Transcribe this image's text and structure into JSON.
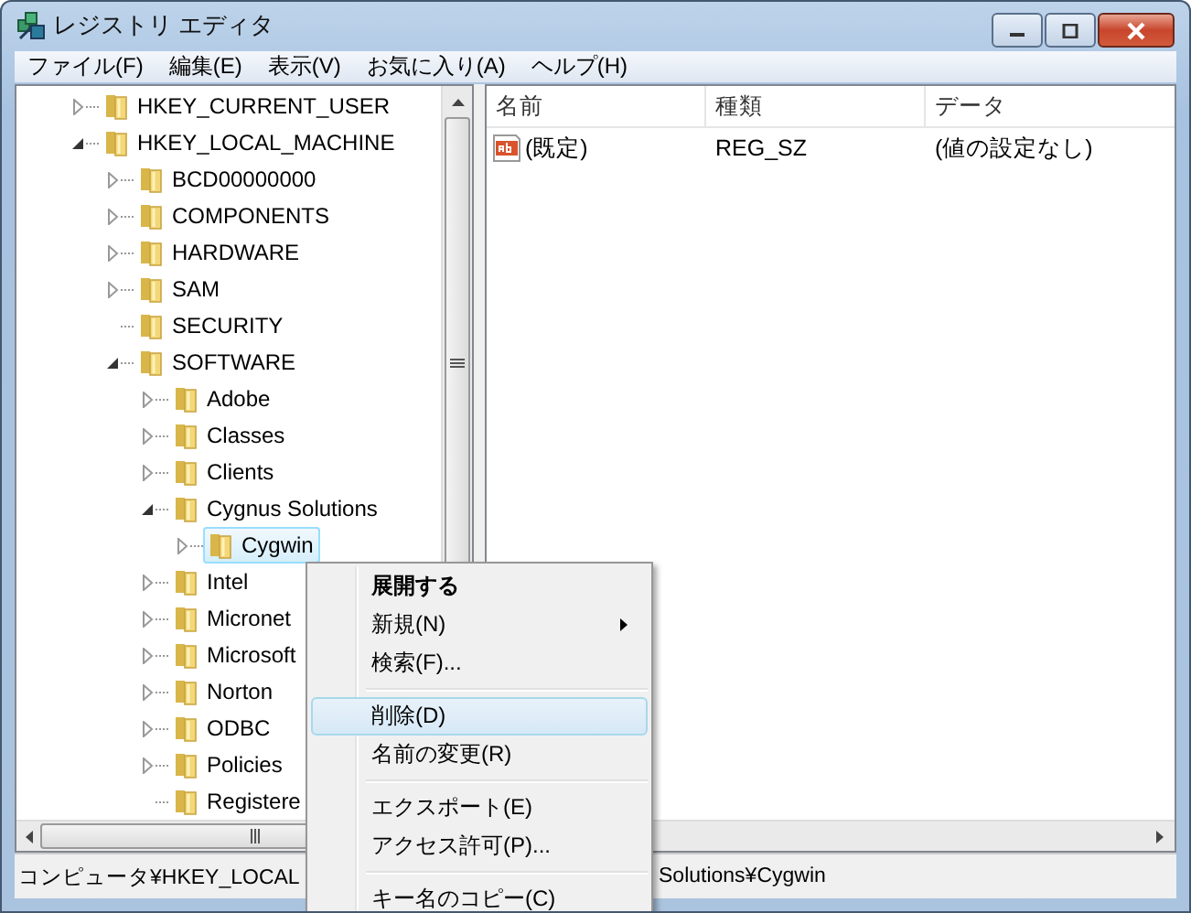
{
  "window": {
    "title": "レジストリ エディタ"
  },
  "menu_bar": [
    "ファイル(F)",
    "編集(E)",
    "表示(V)",
    "お気に入り(A)",
    "ヘルプ(H)"
  ],
  "tree": [
    {
      "label": "HKEY_CURRENT_USER",
      "expandable": true,
      "expanded": false,
      "selected": false
    },
    {
      "label": "HKEY_LOCAL_MACHINE",
      "expandable": true,
      "expanded": true,
      "selected": false,
      "children": [
        {
          "label": "BCD00000000",
          "expandable": true,
          "expanded": false,
          "selected": false
        },
        {
          "label": "COMPONENTS",
          "expandable": true,
          "expanded": false,
          "selected": false
        },
        {
          "label": "HARDWARE",
          "expandable": true,
          "expanded": false,
          "selected": false
        },
        {
          "label": "SAM",
          "expandable": true,
          "expanded": false,
          "selected": false
        },
        {
          "label": "SECURITY",
          "expandable": false,
          "selected": false
        },
        {
          "label": "SOFTWARE",
          "expandable": true,
          "expanded": true,
          "selected": false,
          "children": [
            {
              "label": "Adobe",
              "expandable": true,
              "expanded": false,
              "selected": false
            },
            {
              "label": "Classes",
              "expandable": true,
              "expanded": false,
              "selected": false
            },
            {
              "label": "Clients",
              "expandable": true,
              "expanded": false,
              "selected": false
            },
            {
              "label": "Cygnus Solutions",
              "expandable": true,
              "expanded": true,
              "selected": false,
              "children": [
                {
                  "label": "Cygwin",
                  "expandable": true,
                  "expanded": false,
                  "selected": true
                }
              ]
            },
            {
              "label": "Intel",
              "expandable": true,
              "expanded": false,
              "selected": false
            },
            {
              "label": "Micronet",
              "expandable": true,
              "expanded": false,
              "selected": false
            },
            {
              "label": "Microsoft",
              "expandable": true,
              "expanded": false,
              "selected": false
            },
            {
              "label": "Norton",
              "expandable": true,
              "expanded": false,
              "selected": false
            },
            {
              "label": "ODBC",
              "expandable": true,
              "expanded": false,
              "selected": false
            },
            {
              "label": "Policies",
              "expandable": true,
              "expanded": false,
              "selected": false
            },
            {
              "label": "Registere",
              "expandable": false,
              "selected": false
            }
          ]
        }
      ]
    }
  ],
  "table": {
    "columns": [
      "名前",
      "種類",
      "データ"
    ],
    "rows": [
      {
        "name": "(既定)",
        "type": "REG_SZ",
        "data": "(値の設定なし)"
      }
    ]
  },
  "status_bar": [
    "コンピュータ¥HKEY_LOCAL",
    "Solutions¥Cygwin"
  ],
  "context_menu": [
    {
      "kind": "item",
      "label": "展開する",
      "bold": true,
      "submenu": false,
      "selected": false
    },
    {
      "kind": "item",
      "label": "新規(N)",
      "bold": false,
      "submenu": true,
      "selected": false
    },
    {
      "kind": "item",
      "label": "検索(F)...",
      "bold": false,
      "submenu": false,
      "selected": false
    },
    {
      "kind": "separator"
    },
    {
      "kind": "item",
      "label": "削除(D)",
      "bold": false,
      "submenu": false,
      "selected": true
    },
    {
      "kind": "item",
      "label": "名前の変更(R)",
      "bold": false,
      "submenu": false,
      "selected": false
    },
    {
      "kind": "separator"
    },
    {
      "kind": "item",
      "label": "エクスポート(E)",
      "bold": false,
      "submenu": false,
      "selected": false
    },
    {
      "kind": "item",
      "label": "アクセス許可(P)...",
      "bold": false,
      "submenu": false,
      "selected": false
    },
    {
      "kind": "separator"
    },
    {
      "kind": "item",
      "label": "キー名のコピー(C)",
      "bold": false,
      "submenu": false,
      "selected": false
    }
  ]
}
